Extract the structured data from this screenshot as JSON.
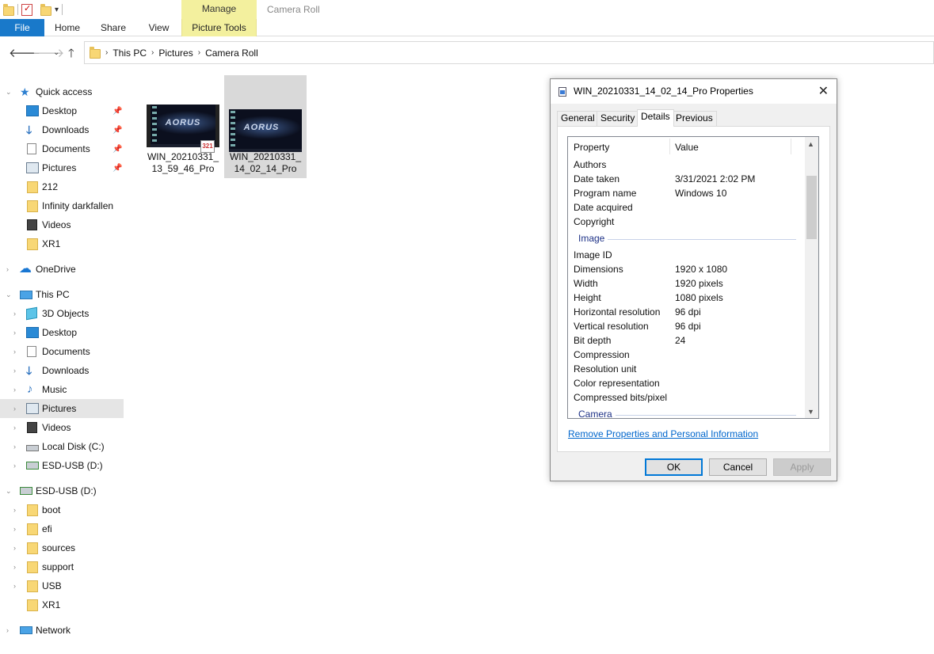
{
  "window": {
    "title": "Camera Roll",
    "contextual_tab_group": "Manage"
  },
  "ribbon": {
    "tabs": [
      "File",
      "Home",
      "Share",
      "View",
      "Picture Tools"
    ]
  },
  "address": {
    "crumbs": [
      "This PC",
      "Pictures",
      "Camera Roll"
    ]
  },
  "sidebar": {
    "quick_access": {
      "label": "Quick access",
      "items": [
        {
          "label": "Desktop",
          "icon": "desktop-icon",
          "pinned": true
        },
        {
          "label": "Downloads",
          "icon": "downloads-icon",
          "pinned": true
        },
        {
          "label": "Documents",
          "icon": "documents-icon",
          "pinned": true
        },
        {
          "label": "Pictures",
          "icon": "pictures-icon",
          "pinned": true
        },
        {
          "label": "212",
          "icon": "folder-icon"
        },
        {
          "label": "Infinity darkfallen",
          "icon": "folder-icon"
        },
        {
          "label": "Videos",
          "icon": "videos-icon"
        },
        {
          "label": "XR1",
          "icon": "folder-icon"
        }
      ]
    },
    "onedrive": {
      "label": "OneDrive"
    },
    "this_pc": {
      "label": "This PC",
      "items": [
        {
          "label": "3D Objects",
          "icon": "3d-objects-icon"
        },
        {
          "label": "Desktop",
          "icon": "desktop-icon"
        },
        {
          "label": "Documents",
          "icon": "documents-icon"
        },
        {
          "label": "Downloads",
          "icon": "downloads-icon"
        },
        {
          "label": "Music",
          "icon": "music-icon"
        },
        {
          "label": "Pictures",
          "icon": "pictures-icon",
          "selected": true
        },
        {
          "label": "Videos",
          "icon": "videos-icon"
        },
        {
          "label": "Local Disk (C:)",
          "icon": "local-disk-icon"
        },
        {
          "label": "ESD-USB (D:)",
          "icon": "usb-drive-icon"
        }
      ]
    },
    "esd_usb": {
      "label": "ESD-USB (D:)",
      "items": [
        {
          "label": "boot",
          "icon": "folder-icon"
        },
        {
          "label": "efi",
          "icon": "folder-icon"
        },
        {
          "label": "sources",
          "icon": "folder-icon"
        },
        {
          "label": "support",
          "icon": "folder-icon"
        },
        {
          "label": "USB",
          "icon": "folder-icon"
        },
        {
          "label": "XR1",
          "icon": "folder-icon"
        }
      ]
    },
    "network": {
      "label": "Network"
    }
  },
  "files": [
    {
      "name": "WIN_20210331_13_59_46_Pro",
      "type": "video",
      "selected": false,
      "badge": "321"
    },
    {
      "name": "WIN_20210331_14_02_14_Pro",
      "type": "image",
      "selected": true
    }
  ],
  "dialog": {
    "title": "WIN_20210331_14_02_14_Pro Properties",
    "tabs": [
      "General",
      "Security",
      "Details",
      "Previous Versions"
    ],
    "active_tab": "Details",
    "columns": [
      "Property",
      "Value"
    ],
    "rows_description": [
      {
        "k": "Authors",
        "v": ""
      },
      {
        "k": "Date taken",
        "v": "3/31/2021 2:02 PM"
      },
      {
        "k": "Program name",
        "v": "Windows 10"
      },
      {
        "k": "Date acquired",
        "v": ""
      },
      {
        "k": "Copyright",
        "v": ""
      }
    ],
    "section_image": "Image",
    "rows_image": [
      {
        "k": "Image ID",
        "v": ""
      },
      {
        "k": "Dimensions",
        "v": "1920 x 1080"
      },
      {
        "k": "Width",
        "v": "1920 pixels"
      },
      {
        "k": "Height",
        "v": "1080 pixels"
      },
      {
        "k": "Horizontal resolution",
        "v": "96 dpi"
      },
      {
        "k": "Vertical resolution",
        "v": "96 dpi"
      },
      {
        "k": "Bit depth",
        "v": "24"
      },
      {
        "k": "Compression",
        "v": ""
      },
      {
        "k": "Resolution unit",
        "v": ""
      },
      {
        "k": "Color representation",
        "v": ""
      },
      {
        "k": "Compressed bits/pixel",
        "v": ""
      }
    ],
    "section_camera": "Camera",
    "remove_link": "Remove Properties and Personal Information",
    "buttons": {
      "ok": "OK",
      "cancel": "Cancel",
      "apply": "Apply"
    }
  },
  "colors": {
    "file_tab": "#1979ca",
    "manage_tab": "#f3f09e",
    "selection": "#d9d9d9",
    "link": "#0066cc",
    "section_header": "#1e3287"
  }
}
